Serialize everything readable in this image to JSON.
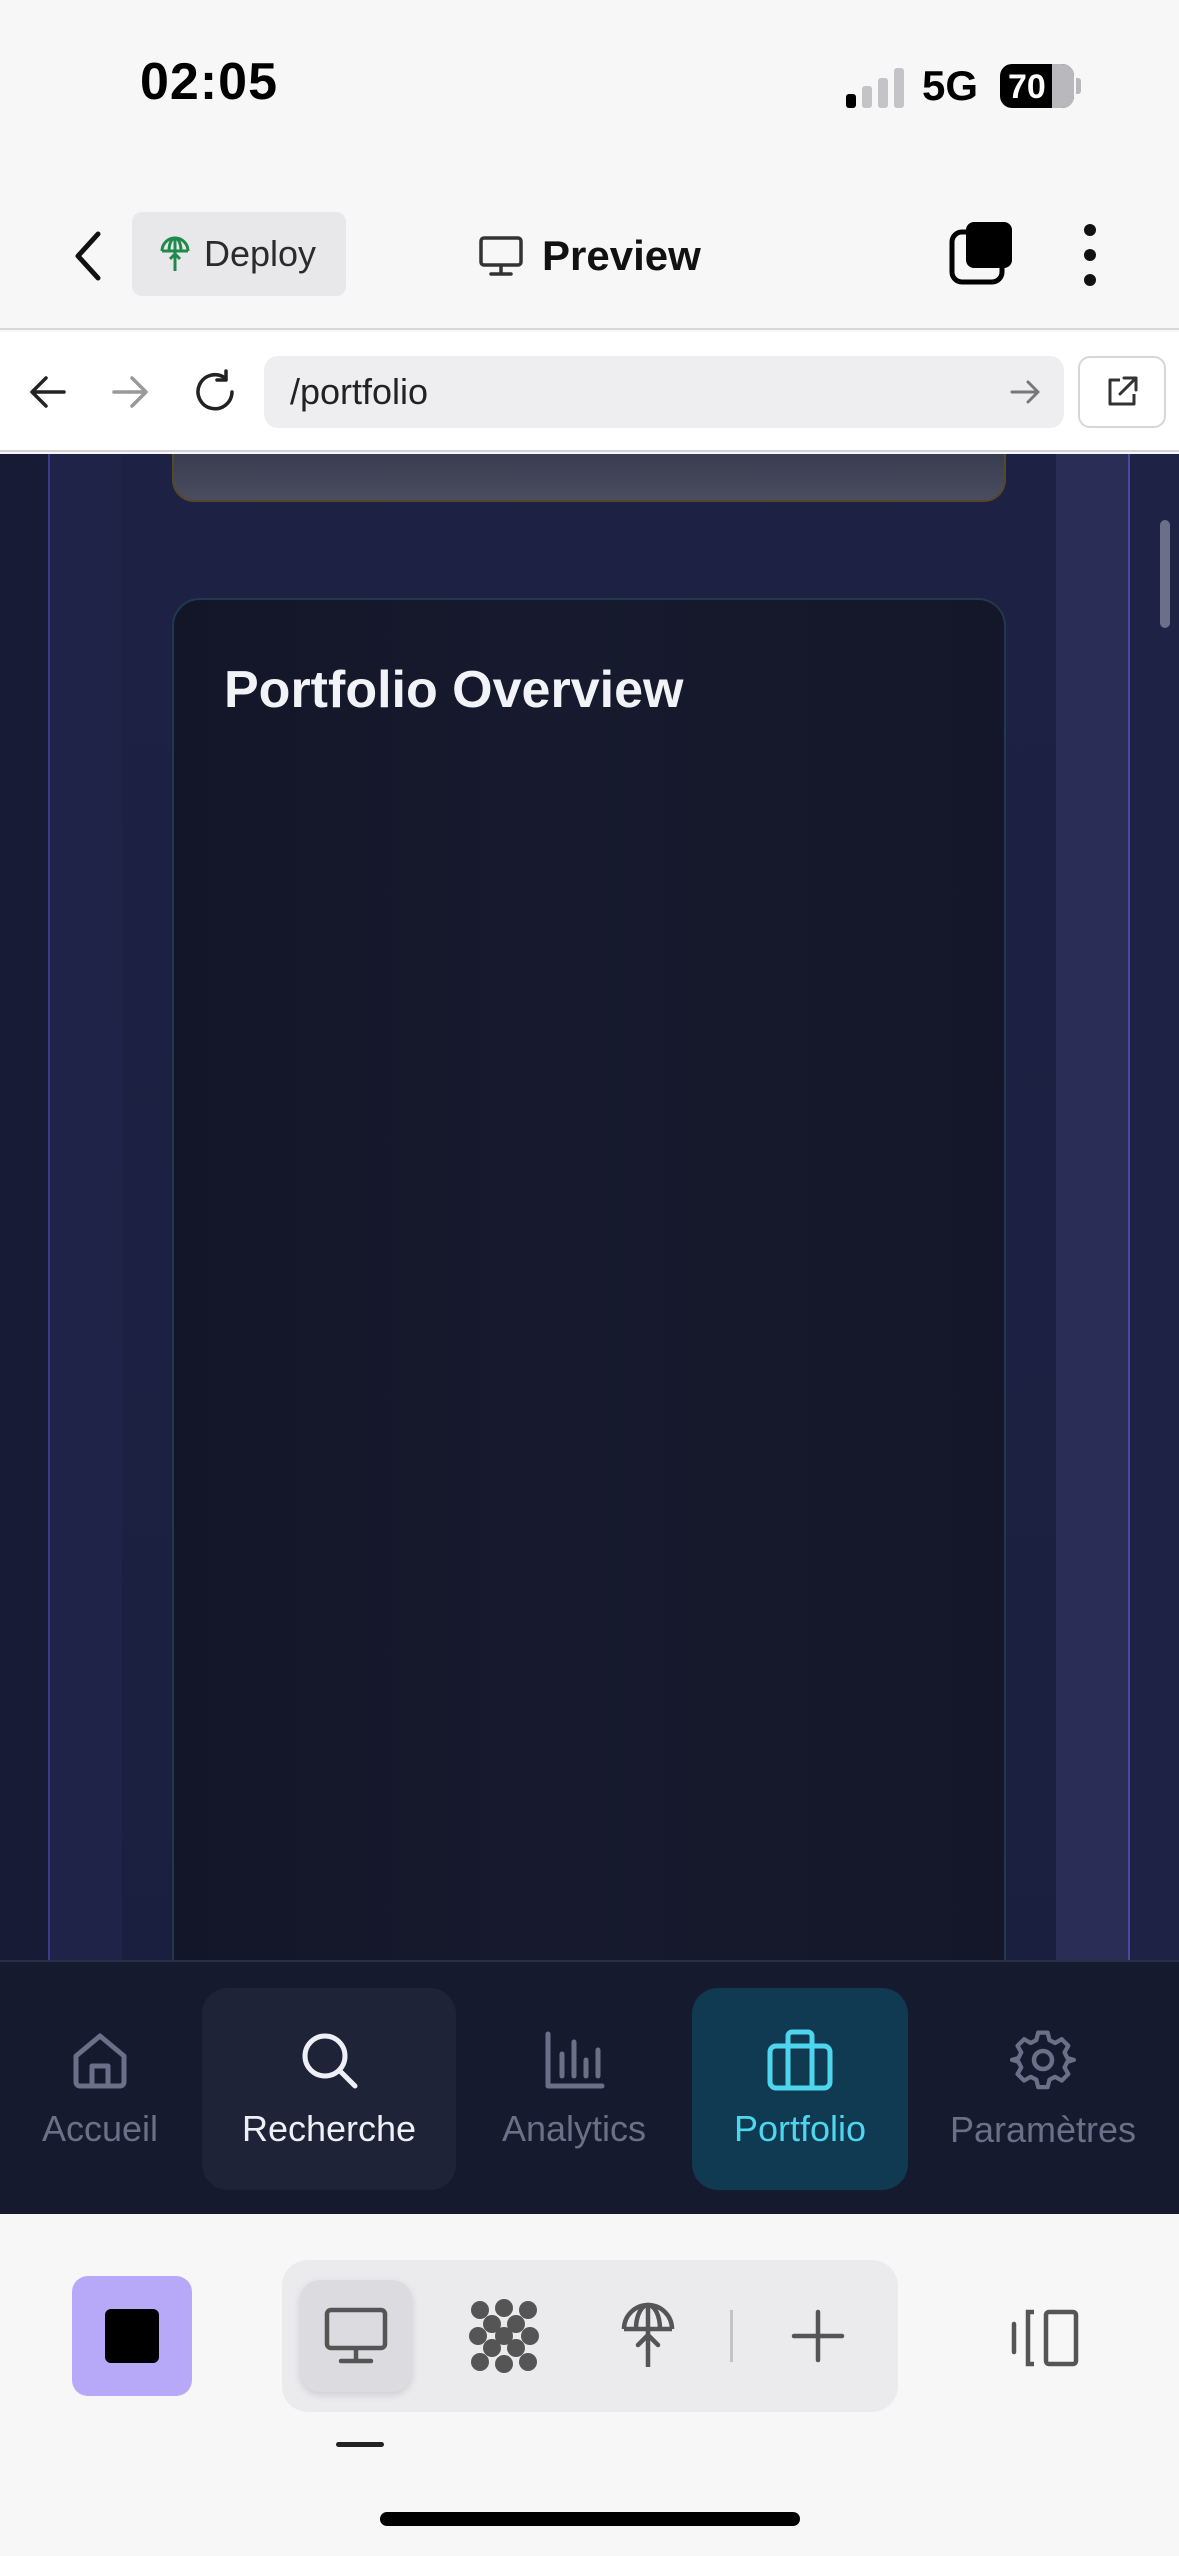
{
  "status_bar": {
    "time": "02:05",
    "network": "5G",
    "battery": "70",
    "signal_bars_active": 1,
    "signal_bars_total": 4
  },
  "app_bar": {
    "deploy_label": "Deploy",
    "preview_label": "Preview"
  },
  "browser": {
    "url": "/portfolio"
  },
  "page": {
    "overview_title": "Portfolio Overview",
    "colors": {
      "background": "#1a1f3d",
      "card": "#131628",
      "accent": "#4fd6ef"
    }
  },
  "bottom_nav": {
    "items": [
      {
        "label": "Accueil",
        "icon": "home-icon",
        "state": "default"
      },
      {
        "label": "Recherche",
        "icon": "search-icon",
        "state": "hover"
      },
      {
        "label": "Analytics",
        "icon": "bar-chart-icon",
        "state": "default"
      },
      {
        "label": "Portfolio",
        "icon": "briefcase-icon",
        "state": "active"
      },
      {
        "label": "Paramètres",
        "icon": "gear-icon",
        "state": "default"
      }
    ]
  },
  "editor_toolbar": {
    "tools": [
      {
        "icon": "monitor-icon",
        "selected": true
      },
      {
        "icon": "dots-logo-icon",
        "selected": false
      },
      {
        "icon": "deploy-icon",
        "selected": false
      },
      {
        "icon": "plus-icon",
        "selected": false
      }
    ],
    "stop_color": "#b8a8f8"
  }
}
